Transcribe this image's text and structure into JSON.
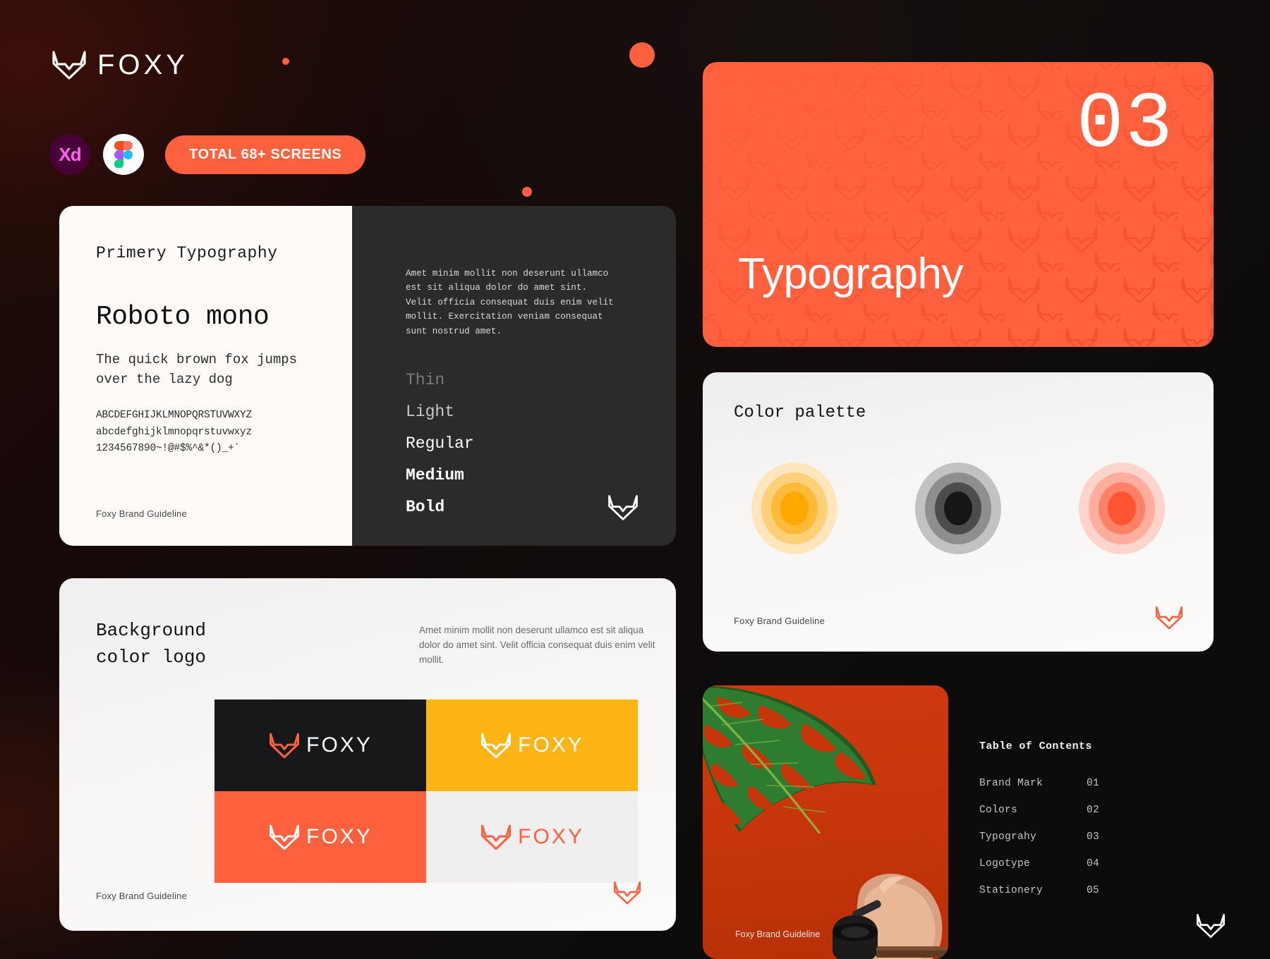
{
  "brand": {
    "name": "FOXY",
    "mark_icon": "fox-head-icon"
  },
  "header": {
    "xd_label": "Xd",
    "figma_label": "Figma",
    "cta_label": "TOTAL 68+ SCREENS"
  },
  "typography_card": {
    "kicker": "Primery Typography",
    "font_name": "Roboto mono",
    "pangram": "The quick brown fox jumps over the lazy dog",
    "glyphs_upper": "ABCDEFGHIJKLMNOPQRSTUVWXYZ",
    "glyphs_lower": "abcdefghijklmnopqrstuvwxyz",
    "glyphs_digits": "1234567890~!@#$%^&*()_+`",
    "footer": "Foxy Brand Guideline",
    "paragraph": "Amet minim mollit non deserunt ullamco est sit aliqua dolor do amet sint. Velit officia consequat duis enim velit mollit. Exercitation veniam consequat sunt nostrud amet.",
    "weights": [
      {
        "label": "Thin"
      },
      {
        "label": "Light"
      },
      {
        "label": "Regular"
      },
      {
        "label": "Medium"
      },
      {
        "label": "Bold"
      }
    ]
  },
  "hero_card": {
    "number": "03",
    "title": "Typography",
    "background_color": "#FF613E"
  },
  "palette_card": {
    "title": "Color palette",
    "footer": "Foxy Brand Guideline",
    "swatches": [
      {
        "name": "amber",
        "core": "#FFA800",
        "ring2": "#FFBB38",
        "ring3": "#FFD07A",
        "ring4": "#FFE6BC"
      },
      {
        "name": "neutral",
        "core": "#161616",
        "ring2": "#4C4C4C",
        "ring3": "#8E8E8E",
        "ring4": "#C2C2C2"
      },
      {
        "name": "coral",
        "core": "#FF5533",
        "ring2": "#FF8168",
        "ring3": "#FFAD9C",
        "ring4": "#FFD4CB"
      }
    ]
  },
  "background_logo_card": {
    "title_line1": "Background",
    "title_line2": "color logo",
    "description": "Amet minim mollit non deserunt ullamco est sit aliqua dolor do amet sint. Velit officia consequat duis enim velit mollit.",
    "footer": "Foxy Brand Guideline",
    "tiles": [
      {
        "name": "dark",
        "bg": "#17181A",
        "mark_color": "#FF613E",
        "word_color": "#FFFFFF",
        "word": "FOXY"
      },
      {
        "name": "amber",
        "bg": "#FDB515",
        "mark_color": "#FFFFFF",
        "word_color": "#FFFFFF",
        "word": "FOXY"
      },
      {
        "name": "coral",
        "bg": "#FF613E",
        "mark_color": "#FFFFFF",
        "word_color": "#FFFFFF",
        "word": "FOXY"
      },
      {
        "name": "light",
        "bg": "#EFEFEF",
        "mark_color": "#FF613E",
        "word_color": "#FF613E",
        "word": "FOXY"
      }
    ]
  },
  "photo_card": {
    "footer": "Foxy Brand Guideline",
    "subject": "monstera-leaf-photo"
  },
  "table_of_contents": {
    "title": "Table of Contents",
    "rows": [
      {
        "label": "Brand Mark",
        "number": "01"
      },
      {
        "label": "Colors",
        "number": "02"
      },
      {
        "label": "Typograhy",
        "number": "03"
      },
      {
        "label": "Logotype",
        "number": "04"
      },
      {
        "label": "Stationery",
        "number": "05"
      }
    ]
  },
  "colors": {
    "accent": "#FF613E",
    "amber": "#FDB515",
    "dark": "#17181A",
    "page_bg": "#0d0a0a"
  }
}
